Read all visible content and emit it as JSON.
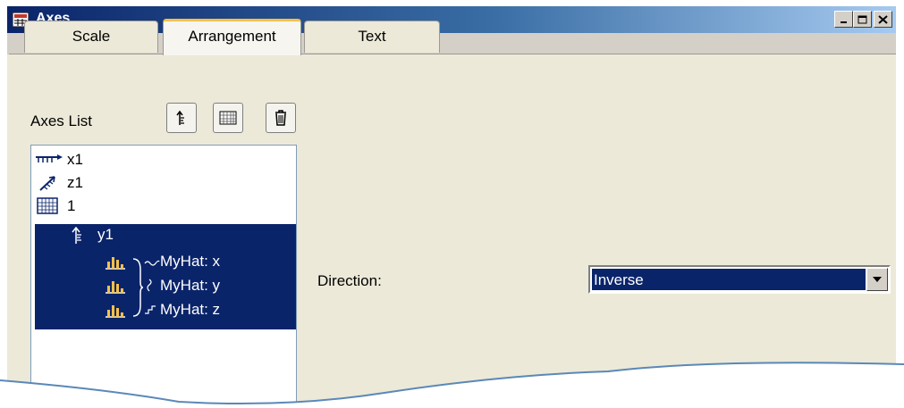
{
  "window": {
    "title": "Axes",
    "icon": "axes-window-icon",
    "controls": [
      "minimize-icon",
      "maximize-icon",
      "close-icon"
    ]
  },
  "tabs": [
    {
      "label": "Scale",
      "active": false
    },
    {
      "label": "Arrangement",
      "active": true
    },
    {
      "label": "Text",
      "active": false
    }
  ],
  "axes_panel": {
    "label": "Axes List",
    "toolbar": [
      "new-axis-icon",
      "new-axis-system-icon",
      "delete-icon"
    ],
    "items": [
      {
        "label": "x1",
        "icon": "x-axis-icon",
        "selected": false
      },
      {
        "label": "z1",
        "icon": "z-axis-icon",
        "selected": false
      },
      {
        "label": "1",
        "icon": "axis-system-icon",
        "selected": false
      },
      {
        "label": "y1",
        "icon": "y-axis-icon",
        "selected": true
      },
      {
        "label": "MyHat: x",
        "icon": "curve-x-icon",
        "selected": true
      },
      {
        "label": "MyHat: y",
        "icon": "curve-y-icon",
        "selected": true
      },
      {
        "label": "MyHat: z",
        "icon": "curve-z-icon",
        "selected": true
      }
    ]
  },
  "direction": {
    "label": "Direction:",
    "value": "Inverse"
  },
  "colors": {
    "selection": "#0a246a",
    "active_tab_accent": "#f6c14a",
    "titlebar_start": "#0a246a",
    "titlebar_end": "#a6caf0"
  }
}
